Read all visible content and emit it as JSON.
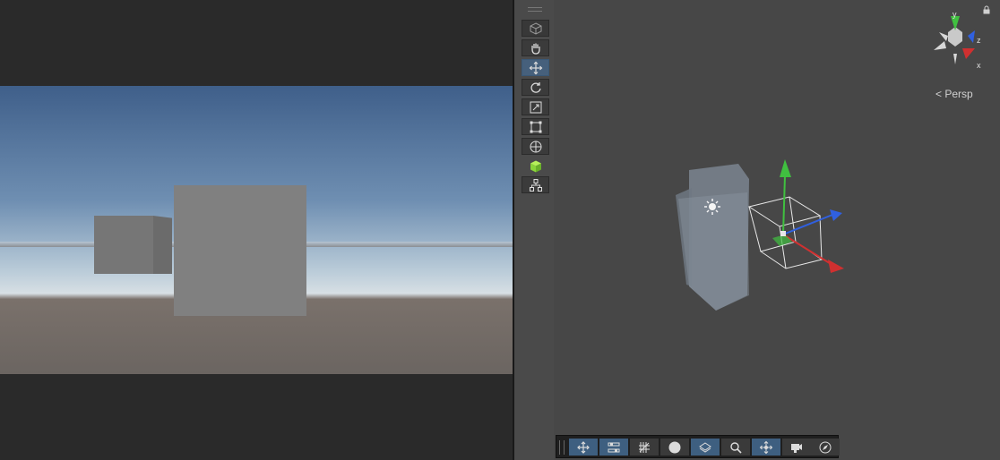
{
  "scene_view": {
    "projection_label": "< Persp",
    "axis_labels": {
      "x": "x",
      "y": "y",
      "z": "z"
    },
    "tools": [
      {
        "name": "view-mode-cube",
        "icon": "cube-icon",
        "active": false
      },
      {
        "name": "hand-tool",
        "icon": "hand-icon",
        "active": false
      },
      {
        "name": "move-tool",
        "icon": "move-arrows-icon",
        "active": true
      },
      {
        "name": "rotate-tool",
        "icon": "rotate-icon",
        "active": false
      },
      {
        "name": "scale-tool",
        "icon": "scale-icon",
        "active": false
      },
      {
        "name": "rect-tool",
        "icon": "rect-transform-icon",
        "active": false
      },
      {
        "name": "transform-tool",
        "icon": "transform-globe-icon",
        "active": false
      },
      {
        "name": "custom-tool-green-cube",
        "icon": "green-cube-icon",
        "active": false
      },
      {
        "name": "custom-tool-hierarchy",
        "icon": "hierarchy-icon",
        "active": false
      }
    ],
    "toolbar": [
      {
        "name": "toolbar-move",
        "icon": "move-arrows-icon",
        "active": true
      },
      {
        "name": "toolbar-settings",
        "icon": "sliders-icon",
        "active": true
      },
      {
        "name": "toolbar-grid",
        "icon": "grid-snap-icon",
        "active": false
      },
      {
        "name": "toolbar-shading",
        "icon": "sphere-icon",
        "active": false
      },
      {
        "name": "toolbar-layers",
        "icon": "layers-icon",
        "active": true
      },
      {
        "name": "toolbar-search",
        "icon": "search-icon",
        "active": false
      },
      {
        "name": "toolbar-pivot",
        "icon": "pivot-icon",
        "active": true
      },
      {
        "name": "toolbar-camera",
        "icon": "camera-icon",
        "active": false
      },
      {
        "name": "toolbar-compass",
        "icon": "compass-icon",
        "active": false
      }
    ]
  },
  "colors": {
    "axis_x": "#d03030",
    "axis_y": "#40c040",
    "axis_z": "#3060e0",
    "active_tool": "#46607c"
  }
}
